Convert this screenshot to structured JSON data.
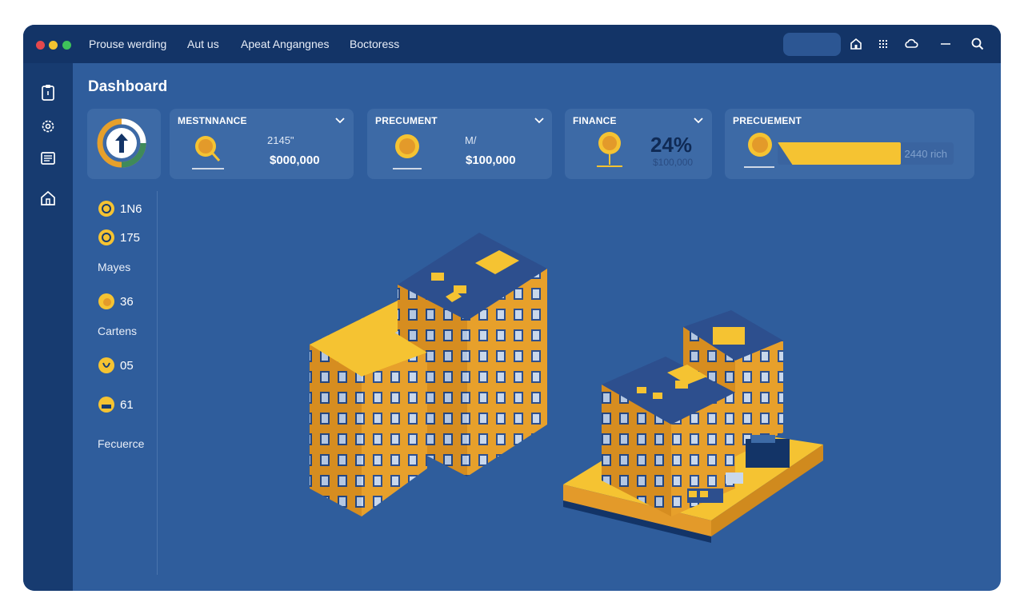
{
  "window": {
    "controls": {
      "close": "#e5484d",
      "minimize": "#f2c230",
      "maximize": "#3ec25a"
    }
  },
  "nav": {
    "tabs": [
      "Prouse werding",
      "Aut us",
      "Apeat Angangnes",
      "Boctoress"
    ]
  },
  "toolbar": {
    "icons": [
      "home-icon",
      "grid-icon",
      "cloud-icon",
      "minimize-icon",
      "search-icon"
    ]
  },
  "sidebar": {
    "icons": [
      "clipboard-icon",
      "settings-icon",
      "document-icon",
      "home-icon"
    ]
  },
  "page": {
    "title": "Dashboard"
  },
  "progress_card": {
    "icon": "up-arrow-icon"
  },
  "cards": [
    {
      "title": "MESTNNANCE",
      "sub": "2145\"",
      "value": "$000,000"
    },
    {
      "title": "PRECUMENT",
      "sub": "M/",
      "value": "$100,000"
    },
    {
      "title": "FINANCE",
      "percent": "24%",
      "value": "$100,000"
    },
    {
      "title": "PRECUEMENT",
      "bar_caption": "2440 rich",
      "bar_fill": 0.7
    }
  ],
  "stats": [
    {
      "number": "1N6",
      "icon": "coin-icon"
    },
    {
      "number": "175",
      "icon": "coin-icon"
    },
    {
      "label": "Mayes"
    },
    {
      "number": "36",
      "icon": "coin-icon"
    },
    {
      "label": "Cartens"
    },
    {
      "number": "05",
      "icon": "coin-icon"
    },
    {
      "number": "61",
      "icon": "coin-icon"
    },
    {
      "label": "Fecuerce"
    }
  ],
  "colors": {
    "accent": "#f5c332",
    "background": "#2f5d9c",
    "titlebar": "#133467",
    "sidebar": "#173b70",
    "card": "#3d6aa6",
    "building_roof": "#2d4f8e",
    "building_orange": "#e7a02b"
  }
}
